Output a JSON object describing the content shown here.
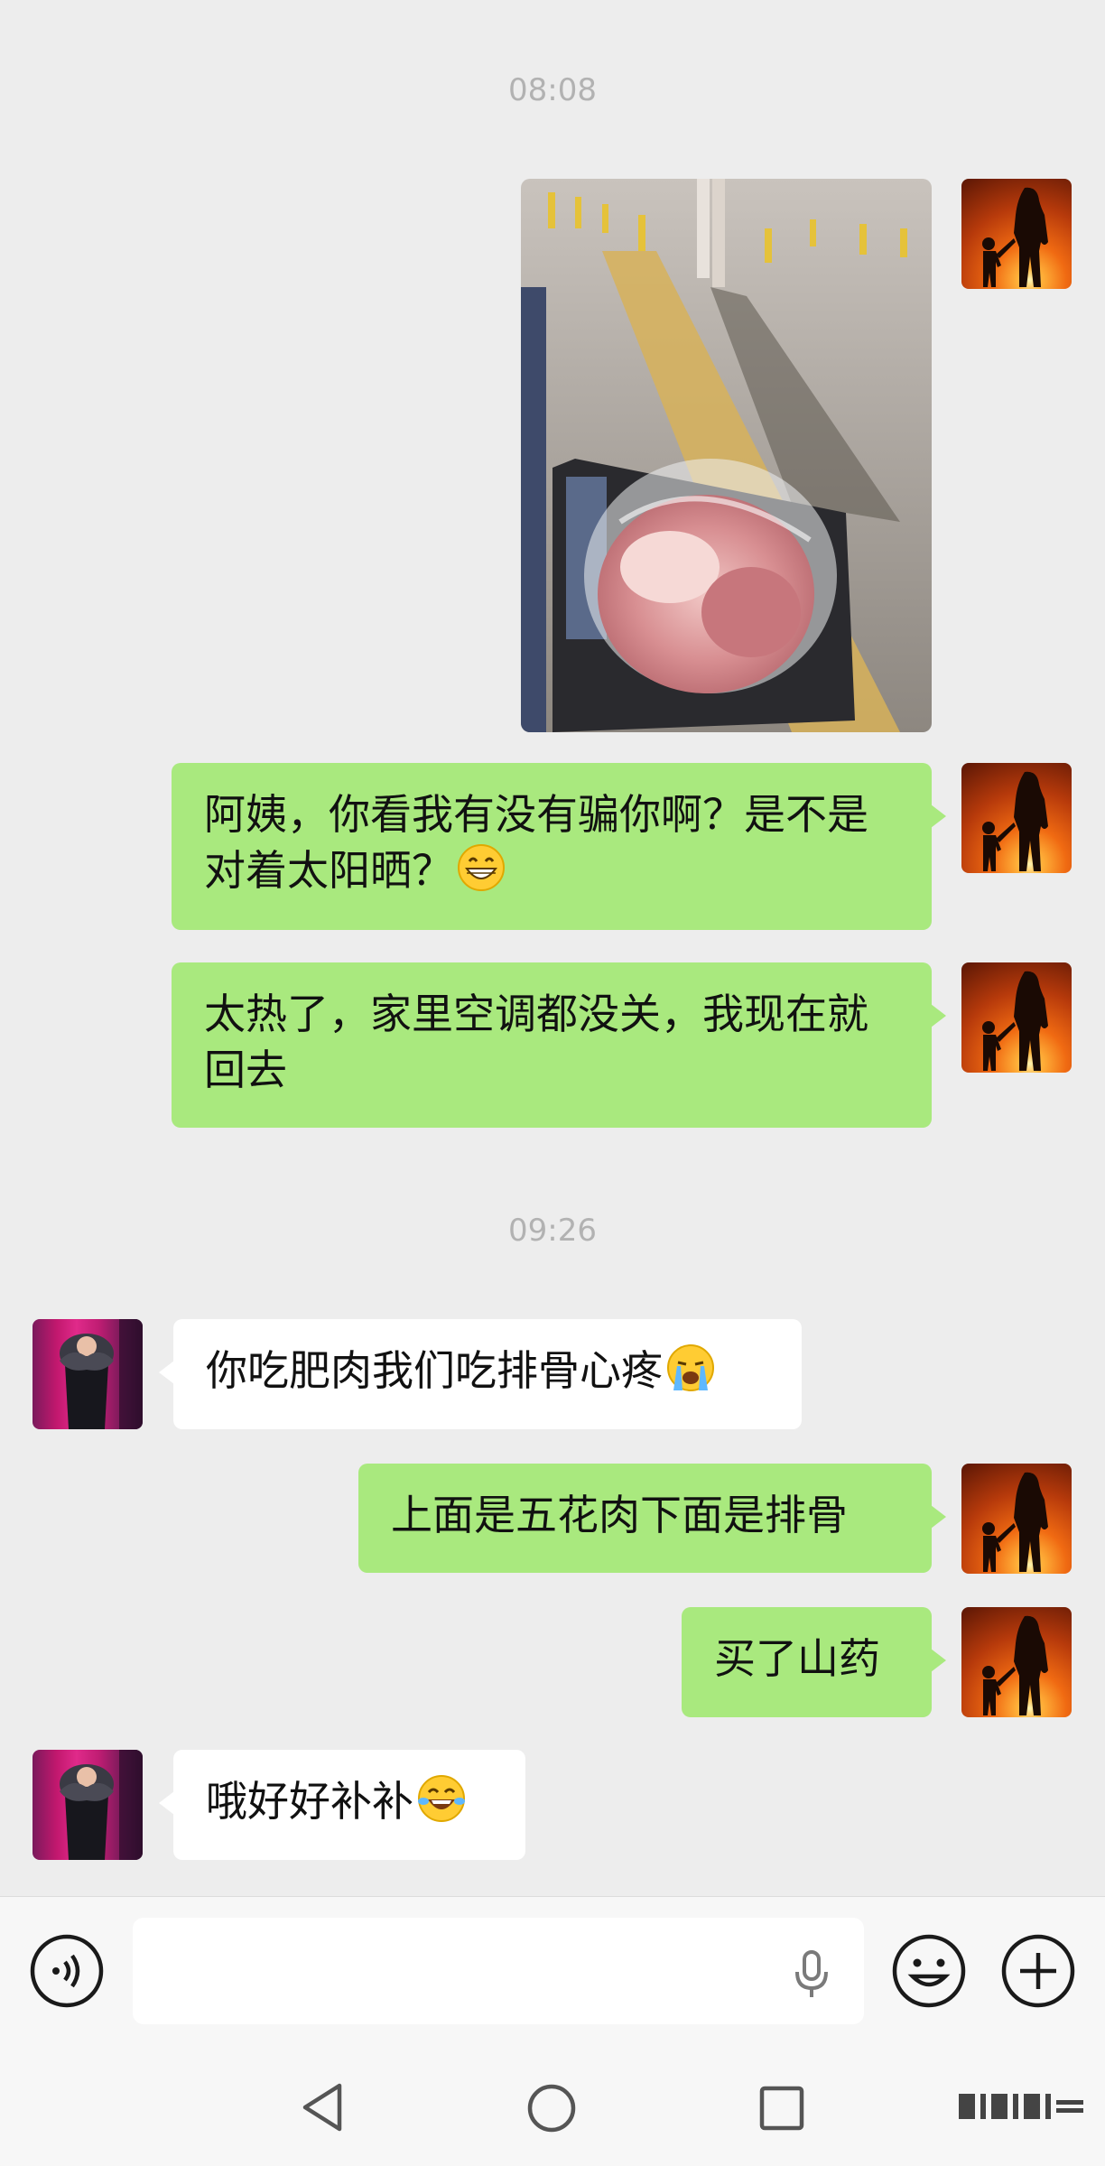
{
  "chat": {
    "timestamps": [
      "08:08",
      "09:26"
    ],
    "messages": [
      {
        "side": "me",
        "type": "image",
        "description_icon": "photo-meat-in-bag"
      },
      {
        "side": "me",
        "type": "text",
        "text": "阿姨，你看我有没有骗你啊？是不是对着太阳晒？",
        "emoji": "grinning-face-emoji"
      },
      {
        "side": "me",
        "type": "text",
        "text": "太热了，家里空调都没关，我现在就回去"
      },
      {
        "side": "them",
        "type": "text",
        "text": "你吃肥肉我们吃排骨心疼",
        "emoji": "loudly-crying-face-emoji"
      },
      {
        "side": "me",
        "type": "text",
        "text": "上面是五花肉下面是排骨"
      },
      {
        "side": "me",
        "type": "text",
        "text": "买了山药"
      },
      {
        "side": "them",
        "type": "text",
        "text": "哦好好补补",
        "emoji": "tears-of-joy-emoji"
      }
    ]
  },
  "input_bar": {
    "icons": [
      "voice-icon",
      "microphone-icon",
      "emoji-icon",
      "plus-icon"
    ],
    "text_value": ""
  },
  "nav_bar": {
    "icons": [
      "back-triangle-icon",
      "home-circle-icon",
      "recent-square-icon",
      "menu-icon"
    ]
  },
  "colors": {
    "background": "#ededed",
    "my_bubble": "#a9e97e",
    "their_bubble": "#ffffff",
    "timestamp_text": "#b2b2b2"
  }
}
